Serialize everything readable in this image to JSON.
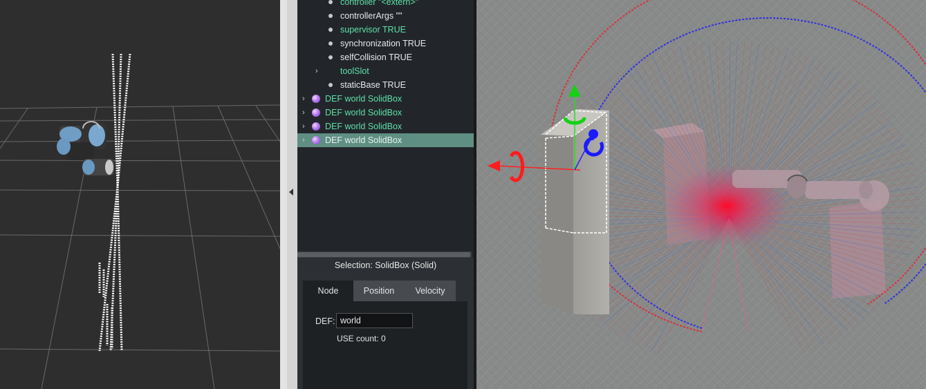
{
  "tree": {
    "items": [
      {
        "label": "controller \"<extern>\"",
        "style": "green",
        "expander": false
      },
      {
        "label": "controllerArgs \"\"",
        "style": "white",
        "expander": false
      },
      {
        "label": "supervisor TRUE",
        "style": "green",
        "expander": false
      },
      {
        "label": "synchronization TRUE",
        "style": "white",
        "expander": false
      },
      {
        "label": "selfCollision TRUE",
        "style": "white",
        "expander": false
      },
      {
        "label": "toolSlot",
        "style": "green",
        "expander": true
      },
      {
        "label": "staticBase TRUE",
        "style": "white",
        "expander": false
      }
    ],
    "defs": [
      {
        "label": "DEF world SolidBox",
        "selected": false
      },
      {
        "label": "DEF world SolidBox",
        "selected": false
      },
      {
        "label": "DEF world SolidBox",
        "selected": false
      },
      {
        "label": "DEF world SolidBox",
        "selected": true
      }
    ]
  },
  "selection": {
    "title": "Selection: SolidBox (Solid)",
    "tabs": {
      "node": "Node",
      "position": "Position",
      "velocity": "Velocity"
    },
    "active_tab": "Node",
    "def_label": "DEF:",
    "def_value": "world",
    "use_count": "USE count: 0"
  },
  "icons": {
    "expander": "chevron-right-icon",
    "solid": "solid-sphere-icon",
    "splitter": "collapse-arrow-icon",
    "translate_x": "red-axis-handle-icon",
    "translate_y": "green-axis-handle-icon",
    "translate_z": "blue-axis-handle-icon"
  },
  "colors": {
    "tree_bg": "#22262b",
    "field_green": "#5ee0a6",
    "selected_row": "#5f8f82",
    "lidar_red": "#e8202a",
    "lidar_blue": "#3030e0"
  }
}
